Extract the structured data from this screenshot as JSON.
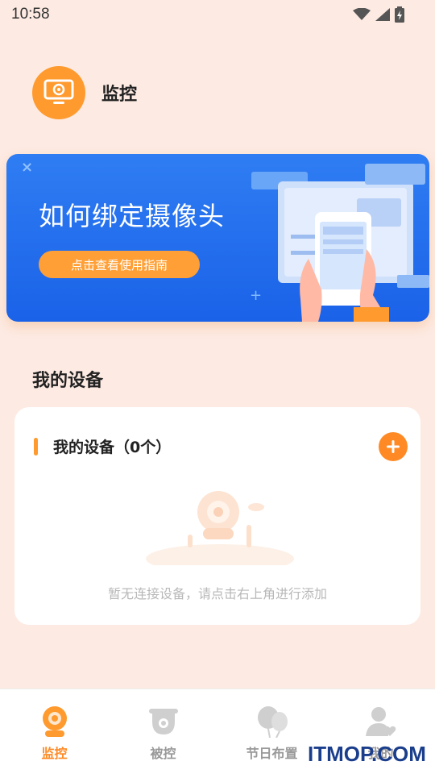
{
  "status_bar": {
    "time": "10:58"
  },
  "header": {
    "title": "监控",
    "logo_icon": "monitor-icon"
  },
  "banner": {
    "title": "如何绑定摄像头",
    "button_label": "点击查看使用指南",
    "close_glyph": "×",
    "plus_glyph": "+"
  },
  "section": {
    "title": "我的设备"
  },
  "device_card": {
    "title": "我的设备（0个）",
    "empty_text": "暂无连接设备，请点击右上角进行添加"
  },
  "tabs": [
    {
      "label": "监控",
      "icon": "camera-icon",
      "active": true
    },
    {
      "label": "被控",
      "icon": "dome-camera-icon",
      "active": false
    },
    {
      "label": "节日布置",
      "icon": "balloon-icon",
      "active": false
    },
    {
      "label": "我的",
      "icon": "user-heart-icon",
      "active": false
    }
  ],
  "watermark": "ITMOP.COM",
  "colors": {
    "accent": "#ff8a25",
    "banner": "#1f6cec",
    "background": "#fdeae2"
  }
}
